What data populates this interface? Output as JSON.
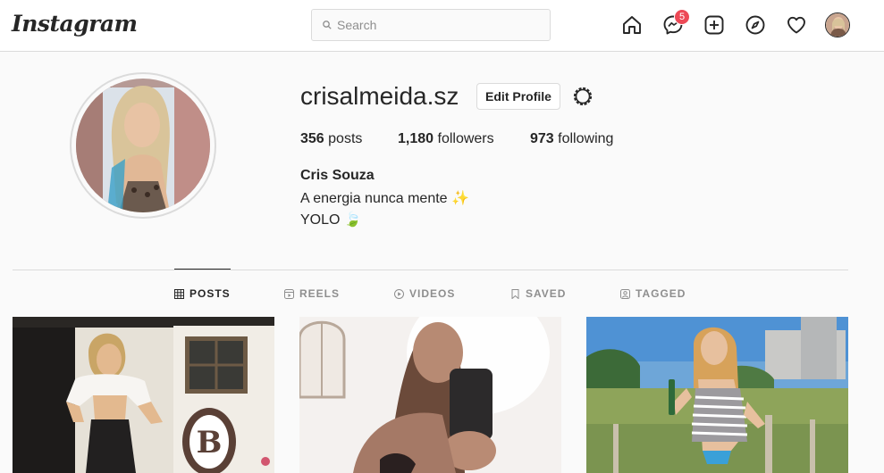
{
  "nav": {
    "logo": "Instagram",
    "search_placeholder": "Search",
    "messages_badge": "5",
    "icons": [
      "home-icon",
      "messenger-icon",
      "new-post-icon",
      "explore-icon",
      "activity-heart-icon"
    ]
  },
  "profile": {
    "username": "crisalmeida.sz",
    "edit_label": "Edit Profile",
    "stats": [
      {
        "count": "356",
        "label": "posts"
      },
      {
        "count": "1,180",
        "label": "followers"
      },
      {
        "count": "973",
        "label": "following"
      }
    ],
    "full_name": "Cris Souza",
    "bio_line1": "A energia nunca mente ✨",
    "bio_line2": "YOLO 🍃"
  },
  "tabs": [
    {
      "label": "POSTS",
      "active": true
    },
    {
      "label": "REELS",
      "active": false
    },
    {
      "label": "VIDEOS",
      "active": false
    },
    {
      "label": "SAVED",
      "active": false
    },
    {
      "label": "TAGGED",
      "active": false
    }
  ],
  "colors": {
    "accent": "#262626",
    "muted": "#8e8e8e",
    "badge": "#ed4956",
    "border": "#dbdbdb"
  }
}
